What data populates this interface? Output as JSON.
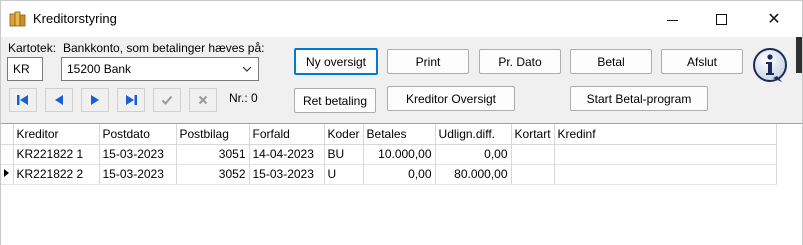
{
  "window": {
    "title": "Kreditorstyring",
    "icon": "ledger-app-icon",
    "controls": {
      "minimize": "minimize-icon",
      "maximize": "maximize-icon",
      "close": "close-icon"
    }
  },
  "form": {
    "kartotek_label": "Kartotek:",
    "kartotek_value": "KR",
    "bank_label": "Bankkonto, som betalinger hæves på:",
    "bank_value": "15200  Bank",
    "nr_label": "Nr.: 0"
  },
  "buttons": {
    "ny_oversigt": "Ny oversigt",
    "print": "Print",
    "pr_dato": "Pr. Dato",
    "betal": "Betal",
    "afslut": "Afslut",
    "ret_betaling": "Ret betaling",
    "kreditor_oversigt": "Kreditor Oversigt",
    "start_betal_program": "Start Betal-program"
  },
  "navigator": [
    "first-record-icon",
    "previous-record-icon",
    "next-record-icon",
    "last-record-icon",
    "post-check-icon",
    "cancel-x-icon"
  ],
  "colors": {
    "nav_blue": "#1a5fd6",
    "disabled_gray": "#9a9a9a",
    "accent": "#0078d7"
  },
  "grid": {
    "columns": [
      "Kreditor",
      "Postdato",
      "Postbilag",
      "Forfald",
      "Koder",
      "Betales",
      "Udlign.diff.",
      "Kortart",
      "Kredinf"
    ],
    "rows": [
      {
        "kreditor": "KR221822  1",
        "postdato": "15-03-2023",
        "postbilag": "3051",
        "forfald": "14-04-2023",
        "koder": "BU",
        "betales": "10.000,00",
        "udlign": "0,00",
        "kortart": "",
        "kredinf": "",
        "current": false
      },
      {
        "kreditor": "KR221822  2",
        "postdato": "15-03-2023",
        "postbilag": "3052",
        "forfald": "15-03-2023",
        "koder": "U",
        "betales": "0,00",
        "udlign": "80.000,00",
        "kortart": "",
        "kredinf": "",
        "current": true
      }
    ]
  }
}
